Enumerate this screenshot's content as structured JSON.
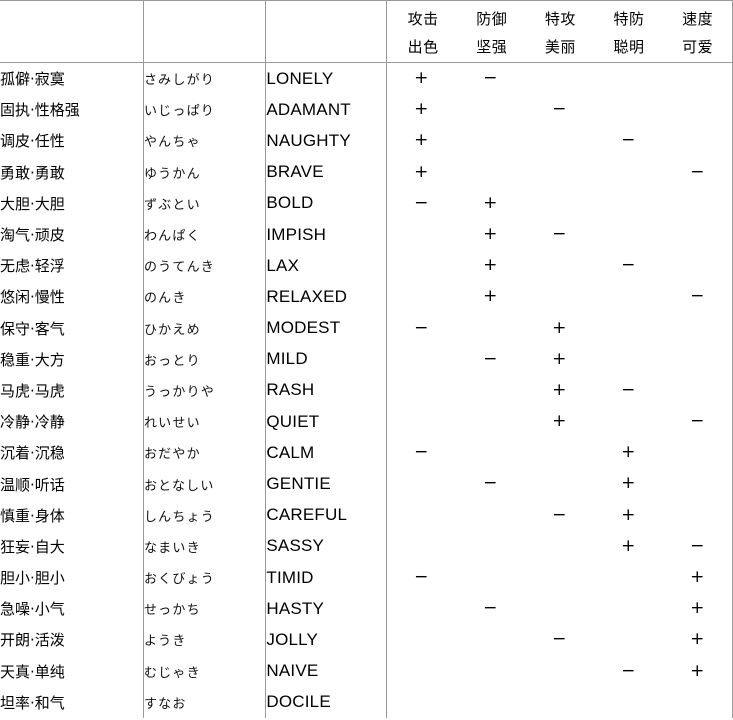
{
  "table": {
    "columns": {
      "chinese_header": "",
      "japanese_header": "",
      "english_header": "",
      "stat_labels_row1": [
        "攻击",
        "防御",
        "特攻",
        "特防",
        "速度"
      ],
      "stat_labels_row2": [
        "出色",
        "坚强",
        "美丽",
        "聪明",
        "可爱"
      ]
    },
    "symbols": {
      "plus": "+",
      "minus": "−",
      "none": ""
    },
    "rows": [
      {
        "chinese": "孤僻·寂寞",
        "japanese": "さみしがり",
        "english": "LONELY",
        "marks": [
          "+",
          "−",
          "",
          "",
          ""
        ]
      },
      {
        "chinese": "固执·性格强",
        "japanese": "いじっぱり",
        "english": "ADAMANT",
        "marks": [
          "+",
          "",
          "−",
          "",
          ""
        ]
      },
      {
        "chinese": "调皮·任性",
        "japanese": "やんちゃ",
        "english": "NAUGHTY",
        "marks": [
          "+",
          "",
          "",
          "−",
          ""
        ]
      },
      {
        "chinese": "勇敢·勇敢",
        "japanese": "ゆうかん",
        "english": "BRAVE",
        "marks": [
          "+",
          "",
          "",
          "",
          "−"
        ]
      },
      {
        "chinese": "大胆·大胆",
        "japanese": "ずぶとい",
        "english": "BOLD",
        "marks": [
          "−",
          "+",
          "",
          "",
          ""
        ]
      },
      {
        "chinese": "淘气·顽皮",
        "japanese": "わんぱく",
        "english": "IMPISH",
        "marks": [
          "",
          "+",
          "−",
          "",
          ""
        ]
      },
      {
        "chinese": "无虑·轻浮",
        "japanese": "のうてんき",
        "english": "LAX",
        "marks": [
          "",
          "+",
          "",
          "−",
          ""
        ]
      },
      {
        "chinese": "悠闲·慢性",
        "japanese": "のんき",
        "english": "RELAXED",
        "marks": [
          "",
          "+",
          "",
          "",
          "−"
        ]
      },
      {
        "chinese": "保守·客气",
        "japanese": "ひかえめ",
        "english": "MODEST",
        "marks": [
          "−",
          "",
          "+",
          "",
          ""
        ]
      },
      {
        "chinese": "稳重·大方",
        "japanese": "おっとり",
        "english": "MILD",
        "marks": [
          "",
          "−",
          "+",
          "",
          ""
        ]
      },
      {
        "chinese": "马虎·马虎",
        "japanese": "うっかりや",
        "english": "RASH",
        "marks": [
          "",
          "",
          "+",
          "−",
          ""
        ]
      },
      {
        "chinese": "冷静·冷静",
        "japanese": "れいせい",
        "english": "QUIET",
        "marks": [
          "",
          "",
          "+",
          "",
          "−"
        ]
      },
      {
        "chinese": "沉着·沉稳",
        "japanese": "おだやか",
        "english": "CALM",
        "marks": [
          "−",
          "",
          "",
          "+",
          ""
        ]
      },
      {
        "chinese": "温顺·听话",
        "japanese": "おとなしい",
        "english": "GENTIE",
        "marks": [
          "",
          "−",
          "",
          "+",
          ""
        ]
      },
      {
        "chinese": "慎重·身体",
        "japanese": "しんちょう",
        "english": "CAREFUL",
        "marks": [
          "",
          "",
          "−",
          "+",
          ""
        ]
      },
      {
        "chinese": "狂妄·自大",
        "japanese": "なまいき",
        "english": "SASSY",
        "marks": [
          "",
          "",
          "",
          "+",
          "−"
        ]
      },
      {
        "chinese": "胆小·胆小",
        "japanese": "おくびょう",
        "english": "TIMID",
        "marks": [
          "−",
          "",
          "",
          "",
          "+"
        ]
      },
      {
        "chinese": "急噪·小气",
        "japanese": "せっかち",
        "english": "HASTY",
        "marks": [
          "",
          "−",
          "",
          "",
          "+"
        ]
      },
      {
        "chinese": "开朗·活泼",
        "japanese": "ようき",
        "english": "JOLLY",
        "marks": [
          "",
          "",
          "−",
          "",
          "+"
        ]
      },
      {
        "chinese": "天真·单纯",
        "japanese": "むじゃき",
        "english": "NAIVE",
        "marks": [
          "",
          "",
          "",
          "−",
          "+"
        ]
      },
      {
        "chinese": "坦率·和气",
        "japanese": "すなお",
        "english": "DOCILE",
        "marks": [
          "",
          "",
          "",
          "",
          ""
        ]
      }
    ]
  },
  "colors": {
    "border": "#9a9a9a",
    "text": "#000000",
    "background": "#ffffff"
  }
}
